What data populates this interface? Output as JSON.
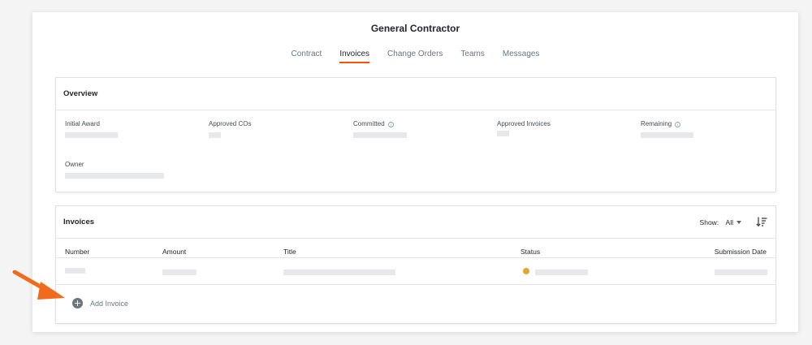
{
  "header": {
    "title": "General Contractor"
  },
  "tabs": [
    {
      "label": "Contract",
      "active": false
    },
    {
      "label": "Invoices",
      "active": true
    },
    {
      "label": "Change Orders",
      "active": false
    },
    {
      "label": "Teams",
      "active": false
    },
    {
      "label": "Messages",
      "active": false
    }
  ],
  "overview": {
    "title": "Overview",
    "fields": {
      "initial_award": "Initial Award",
      "approved_cos": "Approved COs",
      "committed": "Committed",
      "approved_invoices": "Approved Invoices",
      "remaining": "Remaining",
      "owner": "Owner"
    }
  },
  "invoices": {
    "title": "Invoices",
    "show_label": "Show:",
    "show_value": "All",
    "columns": [
      "Number",
      "Amount",
      "Title",
      "Status",
      "Submission Date"
    ],
    "add_label": "Add Invoice"
  },
  "colors": {
    "accent": "#ff5200",
    "status": "#e2a72e",
    "arrow": "#f26a1b"
  }
}
